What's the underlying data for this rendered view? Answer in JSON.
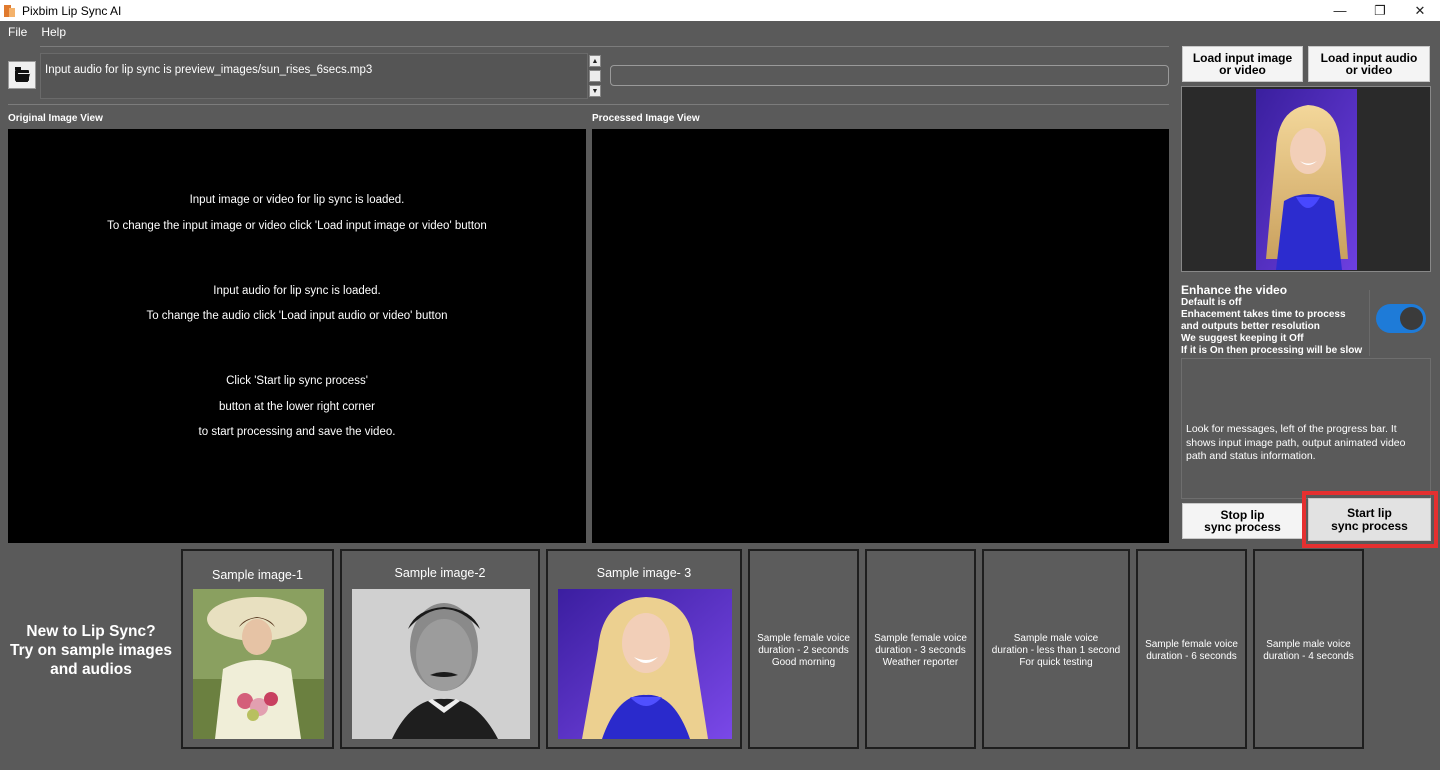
{
  "window": {
    "title": "Pixbim Lip Sync AI",
    "controls": [
      "—",
      "❐",
      "✕"
    ]
  },
  "menu": [
    "File",
    "Help"
  ],
  "message": "Input audio for lip sync is preview_images/sun_rises_6secs.mp3",
  "progress": 0,
  "views": {
    "original_label": "Original Image View",
    "processed_label": "Processed Image View",
    "original_lines": [
      "Input image or video for lip sync is loaded.",
      "To change the input image or video click 'Load input image or video' button",
      "",
      "Input audio for lip sync is loaded.",
      "To change the audio click 'Load input audio or video' button",
      "",
      "Click 'Start lip sync process'",
      "button at the lower right corner",
      "to start processing and save the video."
    ]
  },
  "buttons": {
    "load_image": "Load input image\nor video",
    "load_audio": "Load input audio\nor video",
    "stop": "Stop lip\nsync process",
    "start": "Start lip\nsync process"
  },
  "enhance": {
    "title": "Enhance the video",
    "lines": [
      "Default is off",
      "Enhacement takes time to process",
      "and outputs better resolution",
      "We suggest keeping it Off",
      "If it is On then processing will be slow"
    ],
    "toggle_on": true,
    "toggle_color": "#1e7bd8"
  },
  "info_text": "Look for messages, left of the progress bar. It shows input image path, output animated video path and status information.",
  "new_to": [
    "New to Lip Sync?",
    "Try on sample images",
    "and audios"
  ],
  "samples": {
    "images": [
      "Sample image-1",
      "Sample image-2",
      "Sample image- 3"
    ],
    "audios": [
      [
        "Sample female voice",
        "duration - 2 seconds",
        "Good morning"
      ],
      [
        "Sample female voice",
        "duration - 3 seconds",
        "Weather reporter"
      ],
      [
        "Sample male voice",
        "duration - less than 1 second",
        "For quick testing"
      ],
      [
        "Sample female voice",
        "duration - 6 seconds"
      ],
      [
        "Sample male voice",
        "duration - 4 seconds"
      ]
    ]
  },
  "icons": {
    "folder": "folder-open-icon",
    "highlight_color": "#e53030"
  }
}
